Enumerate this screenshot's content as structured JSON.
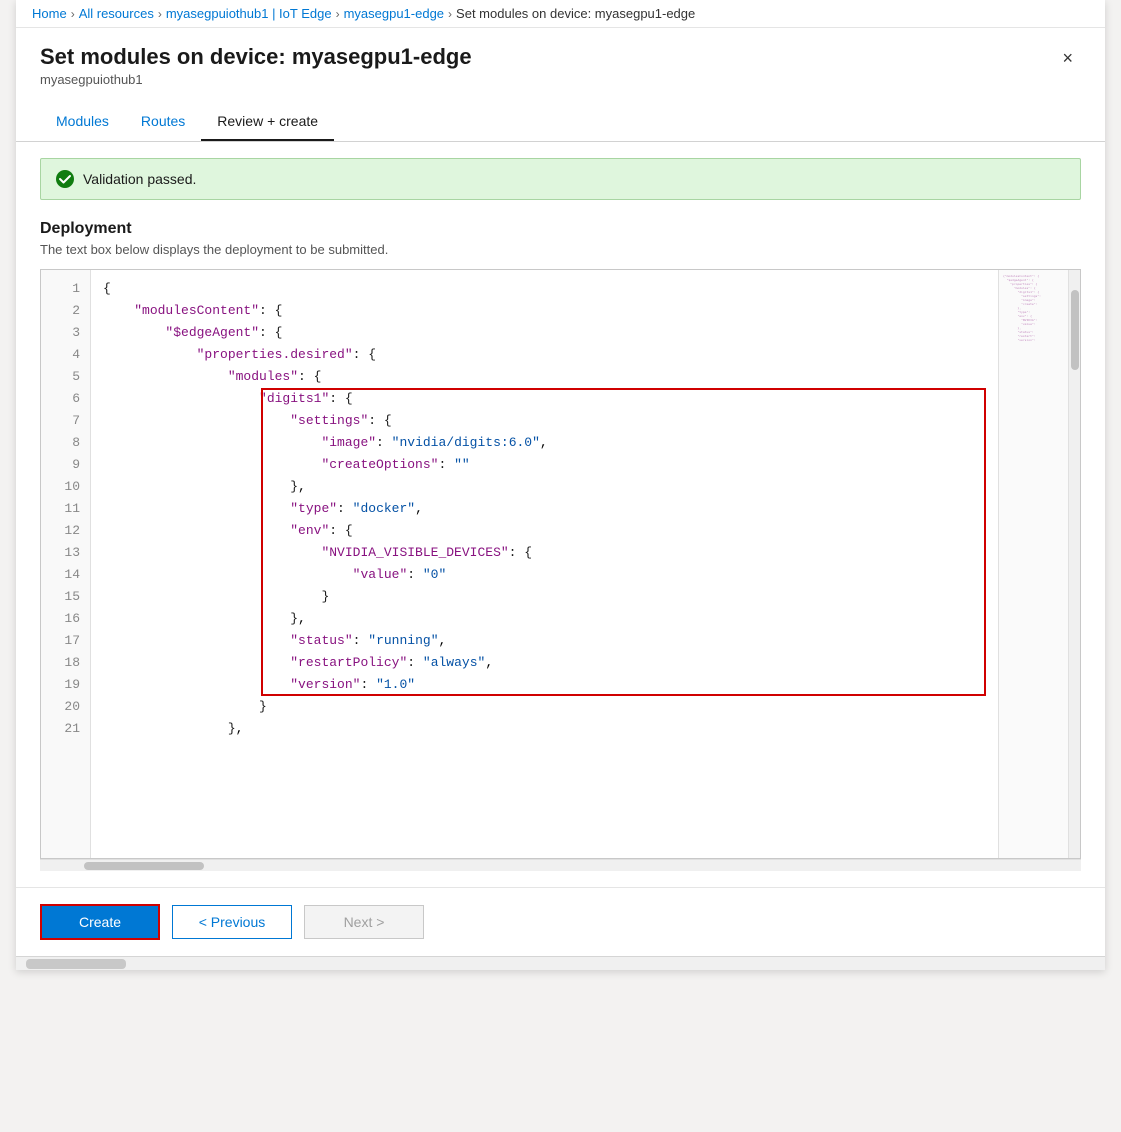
{
  "breadcrumb": {
    "items": [
      {
        "label": "Home",
        "link": true
      },
      {
        "label": "All resources",
        "link": true
      },
      {
        "label": "myasegpuiothub1 | IoT Edge",
        "link": true
      },
      {
        "label": "myasegpu1-edge",
        "link": true
      },
      {
        "label": "Set modules on device: myasegpu1-edge",
        "link": false
      }
    ]
  },
  "header": {
    "title": "Set modules on device: myasegpu1-edge",
    "subtitle": "myasegpuiothub1",
    "close_label": "×"
  },
  "tabs": [
    {
      "label": "Modules",
      "active": false
    },
    {
      "label": "Routes",
      "active": false
    },
    {
      "label": "Review + create",
      "active": true
    }
  ],
  "validation": {
    "text": "Validation passed."
  },
  "deployment": {
    "title": "Deployment",
    "description": "The text box below displays the deployment to be submitted."
  },
  "code": {
    "lines": [
      {
        "num": 1,
        "content": "{"
      },
      {
        "num": 2,
        "content": "    \"modulesContent\": {"
      },
      {
        "num": 3,
        "content": "        \"$edgeAgent\": {"
      },
      {
        "num": 4,
        "content": "            \"properties.desired\": {"
      },
      {
        "num": 5,
        "content": "                \"modules\": {"
      },
      {
        "num": 6,
        "content": "                    \"digits1\": {"
      },
      {
        "num": 7,
        "content": "                        \"settings\": {"
      },
      {
        "num": 8,
        "content": "                            \"image\": \"nvidia/digits:6.0\","
      },
      {
        "num": 9,
        "content": "                            \"createOptions\": \"\""
      },
      {
        "num": 10,
        "content": "                        },"
      },
      {
        "num": 11,
        "content": "                        \"type\": \"docker\","
      },
      {
        "num": 12,
        "content": "                        \"env\": {"
      },
      {
        "num": 13,
        "content": "                            \"NVIDIA_VISIBLE_DEVICES\": {"
      },
      {
        "num": 14,
        "content": "                                \"value\": \"0\""
      },
      {
        "num": 15,
        "content": "                            }"
      },
      {
        "num": 16,
        "content": "                        },"
      },
      {
        "num": 17,
        "content": "                        \"status\": \"running\","
      },
      {
        "num": 18,
        "content": "                        \"restartPolicy\": \"always\","
      },
      {
        "num": 19,
        "content": "                        \"version\": \"1.0\""
      },
      {
        "num": 20,
        "content": "                    }"
      },
      {
        "num": 21,
        "content": "                },"
      }
    ]
  },
  "footer": {
    "create_label": "Create",
    "previous_label": "< Previous",
    "next_label": "Next >"
  }
}
